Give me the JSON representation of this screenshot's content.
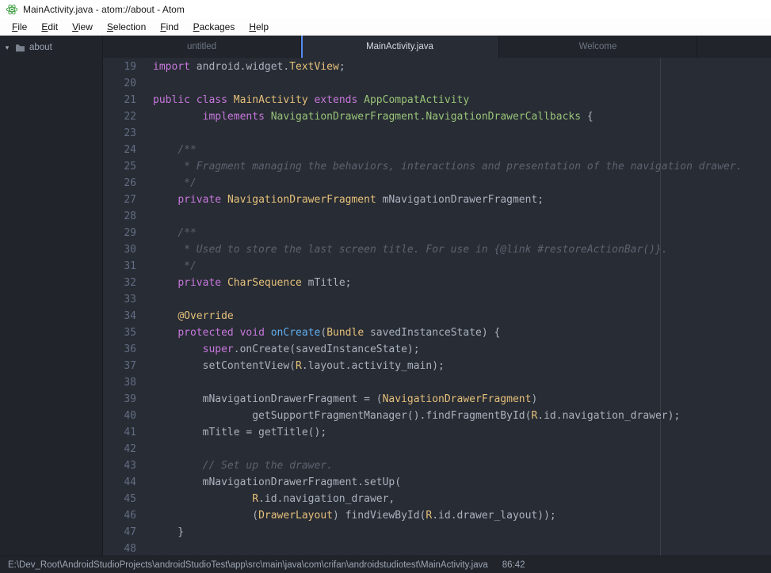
{
  "title_bar": {
    "title": "MainActivity.java - atom://about - Atom"
  },
  "menu_bar": {
    "items": [
      "File",
      "Edit",
      "View",
      "Selection",
      "Find",
      "Packages",
      "Help"
    ]
  },
  "tabs": [
    {
      "label": "untitled",
      "active": false
    },
    {
      "label": "MainActivity.java",
      "active": true
    },
    {
      "label": "Welcome",
      "active": false
    }
  ],
  "tree": {
    "root_label": "about"
  },
  "status_bar": {
    "path": "E:\\Dev_Root\\AndroidStudioProjects\\androidStudioTest\\app\\src\\main\\java\\com\\crifan\\androidstudiotest\\MainActivity.java",
    "cursor_position": "86:42"
  },
  "colors": {
    "editor_bg": "#282c34",
    "panel_bg": "#21252b",
    "accent_blue": "#568af2",
    "keyword": "#c678dd",
    "type": "#e5c07b",
    "inherited_class": "#98c379",
    "function": "#61afef",
    "comment": "#5c6370",
    "plain": "#abb2bf"
  },
  "icons": {
    "app": "atom-icon",
    "tree_expand": "chevron-down-icon",
    "tree_folder": "folder-icon"
  },
  "editor": {
    "lines": [
      {
        "num": 19,
        "seg": [
          [
            "k",
            "import"
          ],
          [
            "p",
            " android.widget."
          ],
          [
            "t",
            "TextView"
          ],
          [
            "p",
            ";"
          ]
        ]
      },
      {
        "num": 20,
        "seg": []
      },
      {
        "num": 21,
        "seg": [
          [
            "k",
            "public"
          ],
          [
            "p",
            " "
          ],
          [
            "k",
            "class"
          ],
          [
            "p",
            " "
          ],
          [
            "t",
            "MainActivity"
          ],
          [
            "p",
            " "
          ],
          [
            "k",
            "extends"
          ],
          [
            "p",
            " "
          ],
          [
            "g",
            "AppCompatActivity"
          ]
        ]
      },
      {
        "num": 22,
        "seg": [
          [
            "p",
            "        "
          ],
          [
            "k",
            "implements"
          ],
          [
            "p",
            " "
          ],
          [
            "g",
            "NavigationDrawerFragment.NavigationDrawerCallbacks"
          ],
          [
            "p",
            " {"
          ]
        ]
      },
      {
        "num": 23,
        "seg": []
      },
      {
        "num": 24,
        "seg": [
          [
            "p",
            "    "
          ],
          [
            "c",
            "/**"
          ]
        ]
      },
      {
        "num": 25,
        "seg": [
          [
            "p",
            "     "
          ],
          [
            "c",
            "* Fragment managing the behaviors, interactions and presentation of the navigation drawer."
          ]
        ]
      },
      {
        "num": 26,
        "seg": [
          [
            "p",
            "     "
          ],
          [
            "c",
            "*/"
          ]
        ]
      },
      {
        "num": 27,
        "seg": [
          [
            "p",
            "    "
          ],
          [
            "k",
            "private"
          ],
          [
            "p",
            " "
          ],
          [
            "t",
            "NavigationDrawerFragment"
          ],
          [
            "p",
            " mNavigationDrawerFragment;"
          ]
        ]
      },
      {
        "num": 28,
        "seg": []
      },
      {
        "num": 29,
        "seg": [
          [
            "p",
            "    "
          ],
          [
            "c",
            "/**"
          ]
        ]
      },
      {
        "num": 30,
        "seg": [
          [
            "p",
            "     "
          ],
          [
            "c",
            "* Used to store the last screen title. For use in {@link #restoreActionBar()}."
          ]
        ]
      },
      {
        "num": 31,
        "seg": [
          [
            "p",
            "     "
          ],
          [
            "c",
            "*/"
          ]
        ]
      },
      {
        "num": 32,
        "seg": [
          [
            "p",
            "    "
          ],
          [
            "k",
            "private"
          ],
          [
            "p",
            " "
          ],
          [
            "t",
            "CharSequence"
          ],
          [
            "p",
            " mTitle;"
          ]
        ]
      },
      {
        "num": 33,
        "seg": []
      },
      {
        "num": 34,
        "seg": [
          [
            "p",
            "    "
          ],
          [
            "t",
            "@Override"
          ]
        ]
      },
      {
        "num": 35,
        "seg": [
          [
            "p",
            "    "
          ],
          [
            "k",
            "protected"
          ],
          [
            "p",
            " "
          ],
          [
            "k",
            "void"
          ],
          [
            "p",
            " "
          ],
          [
            "f",
            "onCreate"
          ],
          [
            "p",
            "("
          ],
          [
            "t",
            "Bundle"
          ],
          [
            "p",
            " savedInstanceState) {"
          ]
        ]
      },
      {
        "num": 36,
        "seg": [
          [
            "p",
            "        "
          ],
          [
            "k",
            "super"
          ],
          [
            "p",
            ".onCreate(savedInstanceState);"
          ]
        ]
      },
      {
        "num": 37,
        "seg": [
          [
            "p",
            "        setContentView("
          ],
          [
            "t",
            "R"
          ],
          [
            "p",
            ".layout.activity_main);"
          ]
        ]
      },
      {
        "num": 38,
        "seg": []
      },
      {
        "num": 39,
        "seg": [
          [
            "p",
            "        mNavigationDrawerFragment = ("
          ],
          [
            "t",
            "NavigationDrawerFragment"
          ],
          [
            "p",
            ")"
          ]
        ]
      },
      {
        "num": 40,
        "seg": [
          [
            "p",
            "                getSupportFragmentManager().findFragmentById("
          ],
          [
            "t",
            "R"
          ],
          [
            "p",
            ".id.navigation_drawer);"
          ]
        ]
      },
      {
        "num": 41,
        "seg": [
          [
            "p",
            "        mTitle = getTitle();"
          ]
        ]
      },
      {
        "num": 42,
        "seg": []
      },
      {
        "num": 43,
        "seg": [
          [
            "p",
            "        "
          ],
          [
            "c",
            "// Set up the drawer."
          ]
        ]
      },
      {
        "num": 44,
        "seg": [
          [
            "p",
            "        mNavigationDrawerFragment.setUp("
          ]
        ]
      },
      {
        "num": 45,
        "seg": [
          [
            "p",
            "                "
          ],
          [
            "t",
            "R"
          ],
          [
            "p",
            ".id.navigation_drawer,"
          ]
        ]
      },
      {
        "num": 46,
        "seg": [
          [
            "p",
            "                ("
          ],
          [
            "t",
            "DrawerLayout"
          ],
          [
            "p",
            ") findViewById("
          ],
          [
            "t",
            "R"
          ],
          [
            "p",
            ".id.drawer_layout));"
          ]
        ]
      },
      {
        "num": 47,
        "seg": [
          [
            "p",
            "    }"
          ]
        ]
      },
      {
        "num": 48,
        "seg": []
      }
    ]
  }
}
